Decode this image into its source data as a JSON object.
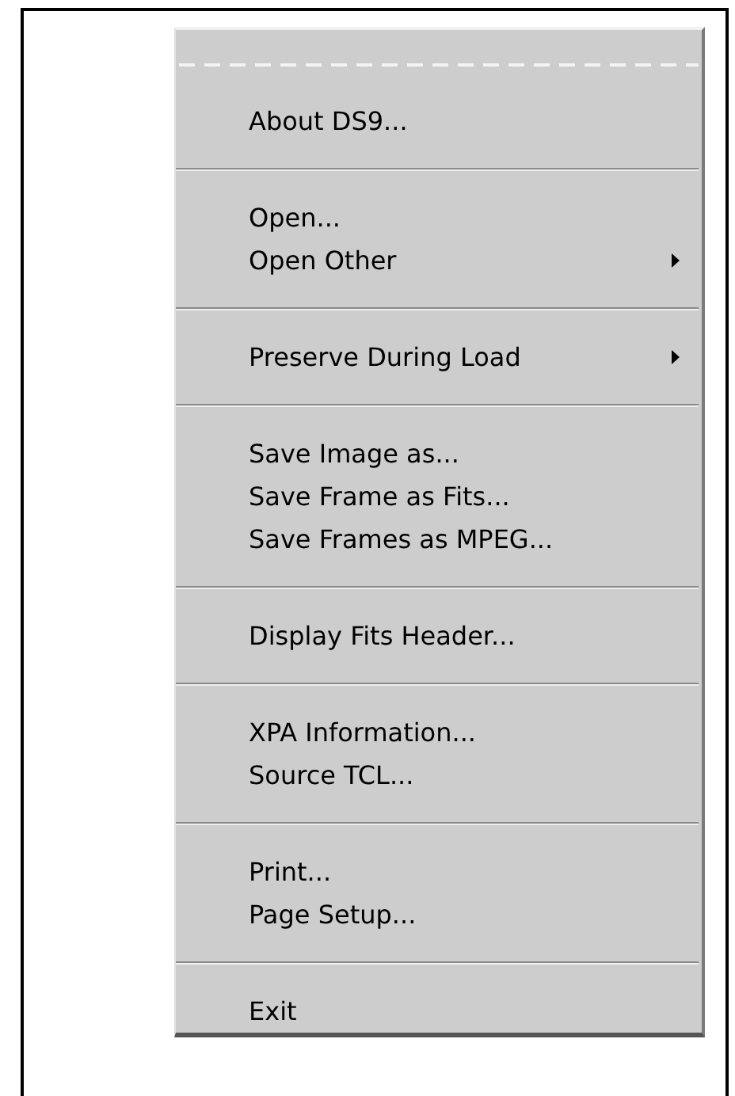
{
  "menu": {
    "tearoff": true,
    "entries": [
      {
        "kind": "item",
        "label": "About DS9...",
        "submenu": false
      },
      {
        "kind": "separator"
      },
      {
        "kind": "item",
        "label": "Open...",
        "submenu": false
      },
      {
        "kind": "item",
        "label": "Open Other",
        "submenu": true
      },
      {
        "kind": "separator"
      },
      {
        "kind": "item",
        "label": "Preserve During Load",
        "submenu": true
      },
      {
        "kind": "separator"
      },
      {
        "kind": "item",
        "label": "Save Image as...",
        "submenu": false
      },
      {
        "kind": "item",
        "label": "Save Frame as Fits...",
        "submenu": false
      },
      {
        "kind": "item",
        "label": "Save Frames as MPEG...",
        "submenu": false
      },
      {
        "kind": "separator"
      },
      {
        "kind": "item",
        "label": "Display Fits Header...",
        "submenu": false
      },
      {
        "kind": "separator"
      },
      {
        "kind": "item",
        "label": "XPA Information...",
        "submenu": false
      },
      {
        "kind": "item",
        "label": "Source TCL...",
        "submenu": false
      },
      {
        "kind": "separator"
      },
      {
        "kind": "item",
        "label": "Print...",
        "submenu": false
      },
      {
        "kind": "item",
        "label": "Page Setup...",
        "submenu": false
      },
      {
        "kind": "separator"
      },
      {
        "kind": "item",
        "label": "Exit",
        "submenu": false
      }
    ]
  }
}
